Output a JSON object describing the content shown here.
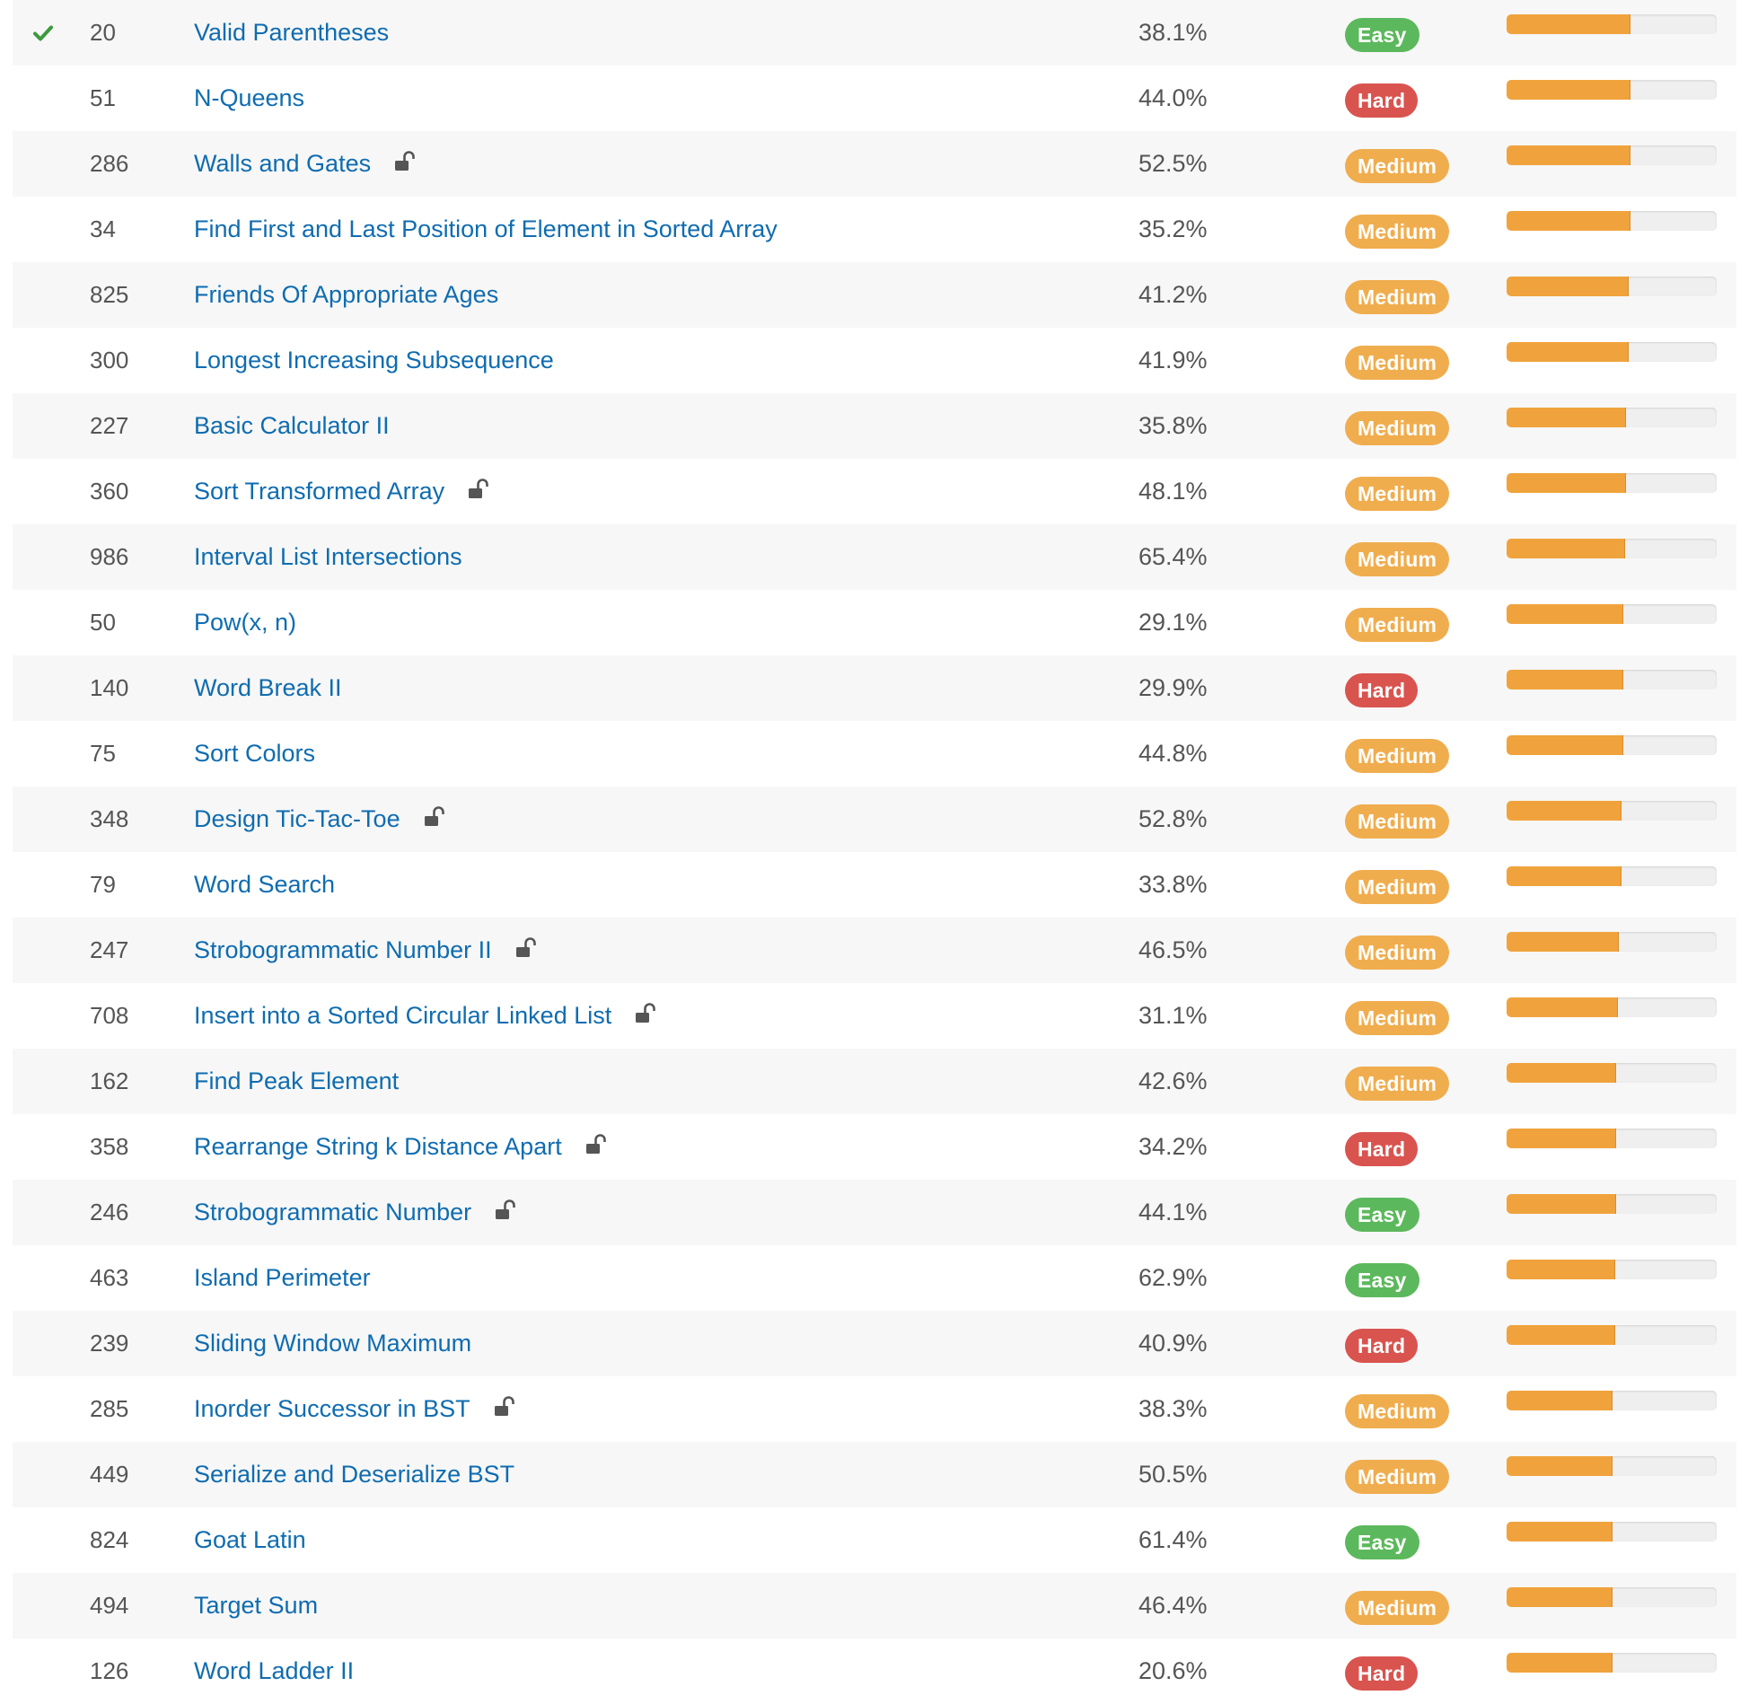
{
  "colors": {
    "link": "#0f6cb0",
    "easy": "#5cb85c",
    "medium": "#f0ad4e",
    "hard": "#d9534f",
    "frequency_bar": "#f0a33c",
    "check": "#3c9a3c"
  },
  "problems": [
    {
      "solved": true,
      "id": "20",
      "title": "Valid Parentheses",
      "locked": false,
      "acceptance": "38.1%",
      "difficulty": "Easy",
      "frequency": 0.59
    },
    {
      "solved": false,
      "id": "51",
      "title": "N-Queens",
      "locked": false,
      "acceptance": "44.0%",
      "difficulty": "Hard",
      "frequency": 0.59
    },
    {
      "solved": false,
      "id": "286",
      "title": "Walls and Gates",
      "locked": true,
      "acceptance": "52.5%",
      "difficulty": "Medium",
      "frequency": 0.59
    },
    {
      "solved": false,
      "id": "34",
      "title": "Find First and Last Position of Element in Sorted Array",
      "locked": false,
      "acceptance": "35.2%",
      "difficulty": "Medium",
      "frequency": 0.59
    },
    {
      "solved": false,
      "id": "825",
      "title": "Friends Of Appropriate Ages",
      "locked": false,
      "acceptance": "41.2%",
      "difficulty": "Medium",
      "frequency": 0.58
    },
    {
      "solved": false,
      "id": "300",
      "title": "Longest Increasing Subsequence",
      "locked": false,
      "acceptance": "41.9%",
      "difficulty": "Medium",
      "frequency": 0.58
    },
    {
      "solved": false,
      "id": "227",
      "title": "Basic Calculator II",
      "locked": false,
      "acceptance": "35.8%",
      "difficulty": "Medium",
      "frequency": 0.57
    },
    {
      "solved": false,
      "id": "360",
      "title": "Sort Transformed Array",
      "locked": true,
      "acceptance": "48.1%",
      "difficulty": "Medium",
      "frequency": 0.57
    },
    {
      "solved": false,
      "id": "986",
      "title": "Interval List Intersections",
      "locked": false,
      "acceptance": "65.4%",
      "difficulty": "Medium",
      "frequency": 0.565
    },
    {
      "solved": false,
      "id": "50",
      "title": "Pow(x, n)",
      "locked": false,
      "acceptance": "29.1%",
      "difficulty": "Medium",
      "frequency": 0.555
    },
    {
      "solved": false,
      "id": "140",
      "title": "Word Break II",
      "locked": false,
      "acceptance": "29.9%",
      "difficulty": "Hard",
      "frequency": 0.555
    },
    {
      "solved": false,
      "id": "75",
      "title": "Sort Colors",
      "locked": false,
      "acceptance": "44.8%",
      "difficulty": "Medium",
      "frequency": 0.555
    },
    {
      "solved": false,
      "id": "348",
      "title": "Design Tic-Tac-Toe",
      "locked": true,
      "acceptance": "52.8%",
      "difficulty": "Medium",
      "frequency": 0.545
    },
    {
      "solved": false,
      "id": "79",
      "title": "Word Search",
      "locked": false,
      "acceptance": "33.8%",
      "difficulty": "Medium",
      "frequency": 0.545
    },
    {
      "solved": false,
      "id": "247",
      "title": "Strobogrammatic Number II",
      "locked": true,
      "acceptance": "46.5%",
      "difficulty": "Medium",
      "frequency": 0.535
    },
    {
      "solved": false,
      "id": "708",
      "title": "Insert into a Sorted Circular Linked List",
      "locked": true,
      "acceptance": "31.1%",
      "difficulty": "Medium",
      "frequency": 0.53
    },
    {
      "solved": false,
      "id": "162",
      "title": "Find Peak Element",
      "locked": false,
      "acceptance": "42.6%",
      "difficulty": "Medium",
      "frequency": 0.52
    },
    {
      "solved": false,
      "id": "358",
      "title": "Rearrange String k Distance Apart",
      "locked": true,
      "acceptance": "34.2%",
      "difficulty": "Hard",
      "frequency": 0.52
    },
    {
      "solved": false,
      "id": "246",
      "title": "Strobogrammatic Number",
      "locked": true,
      "acceptance": "44.1%",
      "difficulty": "Easy",
      "frequency": 0.52
    },
    {
      "solved": false,
      "id": "463",
      "title": "Island Perimeter",
      "locked": false,
      "acceptance": "62.9%",
      "difficulty": "Easy",
      "frequency": 0.515
    },
    {
      "solved": false,
      "id": "239",
      "title": "Sliding Window Maximum",
      "locked": false,
      "acceptance": "40.9%",
      "difficulty": "Hard",
      "frequency": 0.515
    },
    {
      "solved": false,
      "id": "285",
      "title": "Inorder Successor in BST",
      "locked": true,
      "acceptance": "38.3%",
      "difficulty": "Medium",
      "frequency": 0.505
    },
    {
      "solved": false,
      "id": "449",
      "title": "Serialize and Deserialize BST",
      "locked": false,
      "acceptance": "50.5%",
      "difficulty": "Medium",
      "frequency": 0.505
    },
    {
      "solved": false,
      "id": "824",
      "title": "Goat Latin",
      "locked": false,
      "acceptance": "61.4%",
      "difficulty": "Easy",
      "frequency": 0.505
    },
    {
      "solved": false,
      "id": "494",
      "title": "Target Sum",
      "locked": false,
      "acceptance": "46.4%",
      "difficulty": "Medium",
      "frequency": 0.505
    },
    {
      "solved": false,
      "id": "126",
      "title": "Word Ladder II",
      "locked": false,
      "acceptance": "20.6%",
      "difficulty": "Hard",
      "frequency": 0.505
    }
  ]
}
